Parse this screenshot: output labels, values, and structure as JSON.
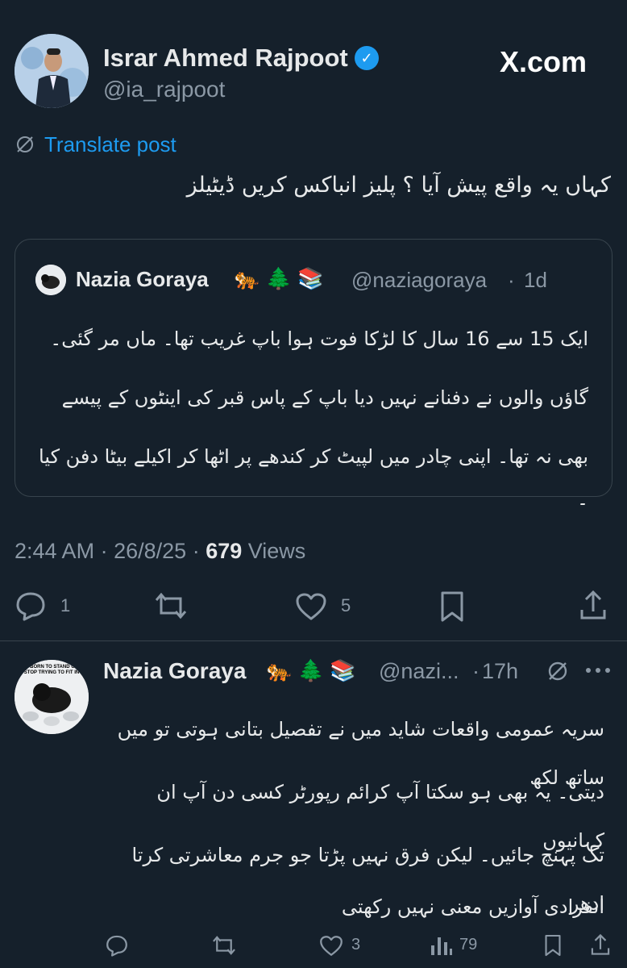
{
  "header": {
    "author_name": "Israr Ahmed Rajpoot",
    "author_handle": "@ia_rajpoot",
    "site_label": "X.com"
  },
  "translate": {
    "label": "Translate post"
  },
  "main_post": {
    "text": "کہاں یہ واقع پیش آیا ؟ پلیز انباکس کریں ڈیٹیلز"
  },
  "quoted_post": {
    "author_name": "Nazia Goraya",
    "emojis": "🐅 🌲 📚",
    "handle": "@naziagoraya",
    "time": "1d",
    "lines": [
      "ایک 15 سے 16 سال کا لڑکا فوت ہوا باپ غریب تھا۔ ماں مر گئی۔",
      "گاؤں والوں نے دفنانے نہیں دیا باپ کے پاس قبر کی اینٹوں کے پیسے",
      "بھی نہ تھا۔ اپنی چادر میں لپیٹ کر کندھے پر اٹھا کر اکیلے بیٹا دفن کیا ۔"
    ]
  },
  "meta": {
    "time": "2:44 AM",
    "date": "26/8/25",
    "views_count": "679",
    "views_label": "Views"
  },
  "actions": {
    "reply_count": "1",
    "repost_count": "",
    "like_count": "5"
  },
  "reply": {
    "author_name": "Nazia Goraya",
    "emojis": "🐅 🌲 📚",
    "handle": "@nazi...",
    "time": "17h",
    "avatar_text": "BE BORN TO STAND OUT STOP TRYING TO FIT IN",
    "lines": [
      "سریہ عمومی واقعات شاید میں نے تفصیل بتانی ہوتی تو میں ساتھ لکھ",
      "دیتی۔ یہ بھی ہو سکتا آپ کرائم رپورٹر کسی دن آپ ان کہانیوں",
      "تک پہنچ جائیں۔ لیکن فرق نہیں پڑتا جو جرم معاشرتی کرتا ادھر",
      "انفرادی آوازیں معنی نہیں رکھتی"
    ],
    "like_count": "3",
    "views_count": "79"
  }
}
